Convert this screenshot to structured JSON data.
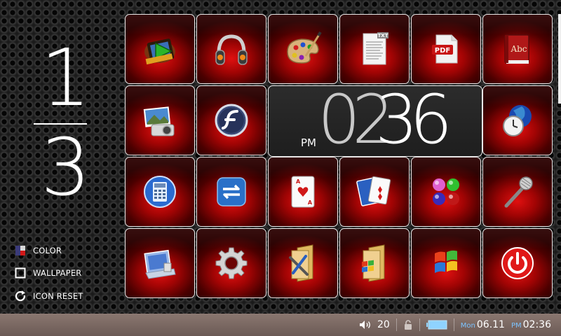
{
  "pager": {
    "current": "1",
    "total": "3"
  },
  "side_options": [
    {
      "label": "COLOR",
      "icon": "color-palette-icon"
    },
    {
      "label": "WALLPAPER",
      "icon": "wallpaper-square-icon"
    },
    {
      "label": "ICON RESET",
      "icon": "refresh-icon"
    }
  ],
  "apps": [
    {
      "name": "video-player",
      "icon": "film-play-icon"
    },
    {
      "name": "music-player",
      "icon": "headphones-icon"
    },
    {
      "name": "paint",
      "icon": "palette-brush-icon"
    },
    {
      "name": "text-viewer",
      "icon": "txt-document-icon",
      "badge": "TXT"
    },
    {
      "name": "pdf-viewer",
      "icon": "pdf-document-icon",
      "badge": "PDF"
    },
    {
      "name": "dictionary",
      "icon": "dictionary-book-icon",
      "badge": "Abc"
    },
    {
      "name": "photo-viewer",
      "icon": "photo-camera-icon"
    },
    {
      "name": "flash-player",
      "icon": "flash-icon"
    },
    {
      "name": "world-clock",
      "icon": "globe-clock-icon"
    },
    {
      "name": "calculator",
      "icon": "calculator-icon"
    },
    {
      "name": "sync",
      "icon": "sync-arrows-icon"
    },
    {
      "name": "solitaire",
      "icon": "ace-card-icon",
      "badge": "A"
    },
    {
      "name": "card-game",
      "icon": "playing-cards-icon"
    },
    {
      "name": "bubble-game",
      "icon": "color-balls-icon"
    },
    {
      "name": "voice-recorder",
      "icon": "microphone-icon"
    },
    {
      "name": "control-panel",
      "icon": "control-panel-icon"
    },
    {
      "name": "settings",
      "icon": "gear-icon"
    },
    {
      "name": "tools-folder",
      "icon": "tools-folder-icon"
    },
    {
      "name": "windows-folder",
      "icon": "windows-folder-icon"
    },
    {
      "name": "windows",
      "icon": "windows-logo-icon"
    },
    {
      "name": "power",
      "icon": "power-icon"
    }
  ],
  "clock": {
    "ampm": "PM",
    "hours": "02",
    "minutes": "36"
  },
  "taskbar": {
    "volume": "20",
    "day": "Mon",
    "date": "06.11",
    "ampm": "PM",
    "time": "02:36",
    "colors": {
      "accent": "#7cc3ff",
      "battery": "#8fd3ff"
    }
  },
  "colors": {
    "tile_red": "#e01010",
    "tile_border": "#e8e8e8"
  }
}
